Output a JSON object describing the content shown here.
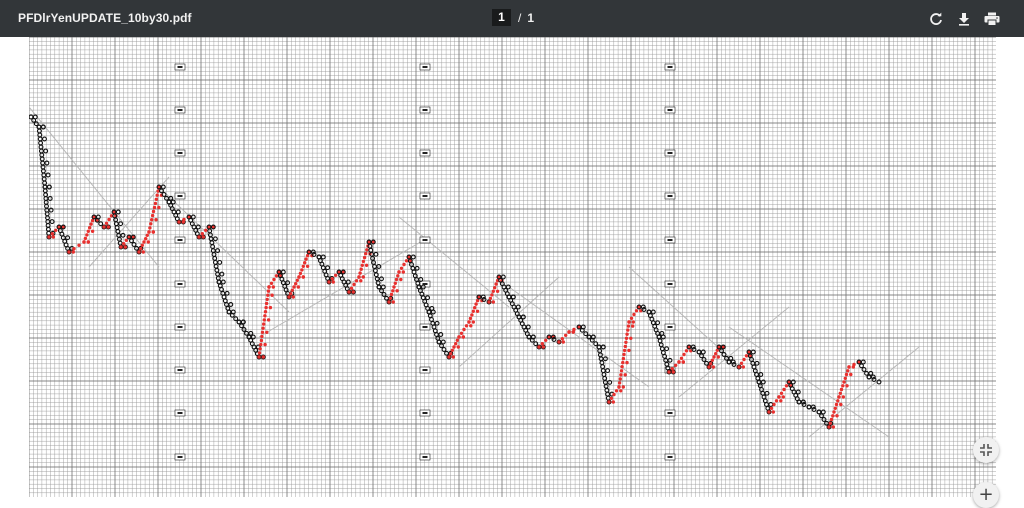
{
  "toolbar": {
    "title": "PFDlrYenUPDATE_10by30.pdf",
    "current_page": "1",
    "separator": "/",
    "total_pages": "1",
    "rotate_icon": "rotate-icon",
    "download_icon": "download-icon",
    "print_icon": "print-icon"
  },
  "controls": {
    "fit_icon": "fit-to-page-icon",
    "zoom_in_label": "+"
  },
  "colors": {
    "toolbar_bg": "#323639",
    "grid_line": "#9a9a9a",
    "x_mark": "#e8312f",
    "o_mark": "#111111",
    "trend_line": "#b8b8b8"
  }
}
